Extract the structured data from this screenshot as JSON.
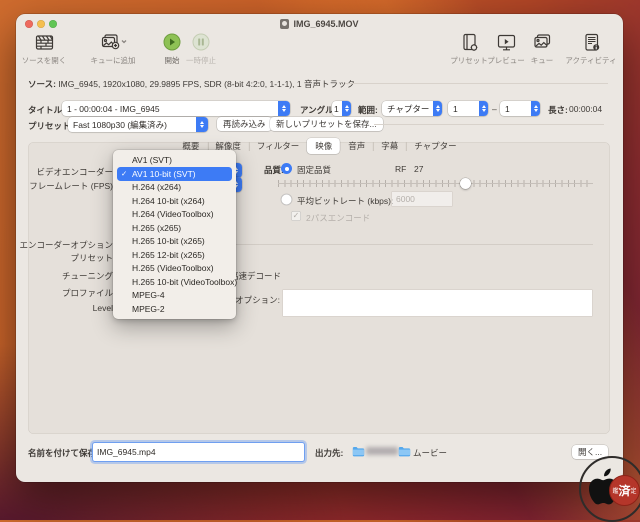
{
  "window": {
    "title": "IMG_6945.MOV"
  },
  "toolbar": {
    "open_source": "ソースを開く",
    "add_to_queue": "キューに追加",
    "start": "開始",
    "pause": "一時停止",
    "presets": "プリセット",
    "preview": "プレビュー",
    "queue": "キュー",
    "activity": "アクティビティ"
  },
  "source": {
    "label": "ソース:",
    "info": "IMG_6945, 1920x1080, 29.9895 FPS, SDR (8-bit 4:2:0, 1-1-1), 1 音声トラック"
  },
  "title_row": {
    "label": "タイトル:",
    "value": "1 - 00:00:04 - IMG_6945",
    "angle_label": "アングル:",
    "angle": "1",
    "range_label": "範囲:",
    "range_type": "チャプター",
    "range_from": "1",
    "range_dash": "–",
    "range_to": "1",
    "length_label": "長さ:",
    "length": "00:00:04"
  },
  "preset_row": {
    "label": "プリセット:",
    "value": "Fast 1080p30 (編集済み)",
    "reload": "再読み込み",
    "save_new": "新しいプリセットを保存..."
  },
  "tabs": [
    {
      "label": "概要"
    },
    {
      "label": "解像度"
    },
    {
      "label": "フィルター"
    },
    {
      "label": "映像",
      "selected": true
    },
    {
      "label": "音声"
    },
    {
      "label": "字幕"
    },
    {
      "label": "チャプター"
    }
  ],
  "video": {
    "encoder_label": "ビデオエンコーダー",
    "framerate_label": "フレームレート (FPS)",
    "quality_label": "品質:",
    "constant_quality": "固定品質",
    "rf_label": "RF",
    "rf_value": "27",
    "avg_bitrate_label": "平均ビットレート (kbps):",
    "avg_bitrate_value": "6000",
    "two_pass": "2パスエンコード",
    "encoder_options_label": "エンコーダーオプション",
    "preset_label": "プリセット",
    "tune_label": "チューニング",
    "fast_decode": "高速デコード",
    "profile_label": "プロファイル",
    "extra_options_label": "追加オプション:",
    "level_label": "Level"
  },
  "encoder_menu": {
    "items": [
      {
        "label": "AV1 (SVT)"
      },
      {
        "label": "AV1 10-bit (SVT)",
        "checked": "✓",
        "selected": true
      },
      {
        "label": "H.264 (x264)"
      },
      {
        "label": "H.264 10-bit (x264)"
      },
      {
        "label": "H.264 (VideoToolbox)"
      },
      {
        "label": "H.265 (x265)"
      },
      {
        "label": "H.265 10-bit (x265)"
      },
      {
        "label": "H.265 12-bit (x265)"
      },
      {
        "label": "H.265 (VideoToolbox)"
      },
      {
        "label": "H.265 10-bit (VideoToolbox)"
      },
      {
        "label": "MPEG-4"
      },
      {
        "label": "MPEG-2"
      }
    ]
  },
  "save_row": {
    "label": "名前を付けて保存:",
    "filename": "IMG_6945.mp4",
    "dest_label": "出力先:",
    "dest_folder": "ムービー",
    "open_button": "開く..."
  },
  "watermark": {
    "stamp_left": "鑑",
    "stamp_center": "済",
    "stamp_right": "定"
  },
  "colors": {
    "accent": "#3d7bf5",
    "start_green": "#8ec155",
    "stamp_red": "#b5362a"
  }
}
